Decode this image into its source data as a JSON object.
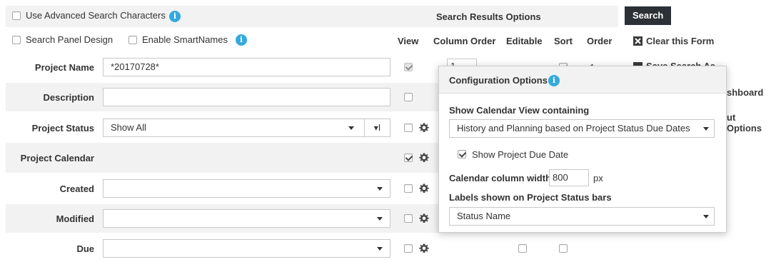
{
  "top_options": {
    "advanced_chars_label": "Use Advanced Search Characters",
    "panel_design_label": "Search Panel Design",
    "smartnames_label": "Enable SmartNames"
  },
  "results_options": {
    "title": "Search Results Options",
    "columns": [
      "View",
      "Column Order",
      "Editable",
      "Sort",
      "Order"
    ]
  },
  "fields": {
    "project_name": {
      "label": "Project Name",
      "value": "*20170728*"
    },
    "description": {
      "label": "Description",
      "value": ""
    },
    "project_status": {
      "label": "Project Status",
      "value": "Show All"
    },
    "project_calendar": {
      "label": "Project Calendar"
    },
    "created": {
      "label": "Created",
      "value": ""
    },
    "modified": {
      "label": "Modified",
      "value": ""
    },
    "due": {
      "label": "Due",
      "value": ""
    }
  },
  "row1_extras": {
    "column_order_value": "1",
    "order_value": "1"
  },
  "actions": {
    "search": "Search",
    "clear_form": "Clear this Form",
    "save_search_as": "Save Search As",
    "dashboard": "shboard",
    "layout_options": "ut Options"
  },
  "config_popup": {
    "title": "Configuration Options",
    "calendar_view_label": "Show Calendar View containing",
    "calendar_view_value": "History and Planning based on Project Status Due Dates",
    "show_due_date_label": "Show Project Due Date",
    "column_width_label": "Calendar column width",
    "column_width_value": "800",
    "column_width_unit": "px",
    "status_bars_label": "Labels shown on Project Status bars",
    "status_bars_value": "Status Name"
  },
  "colors": {
    "accent": "#33a9dd",
    "button_dark": "#2b3136",
    "band": "#f2f2f2"
  },
  "icons": [
    "info-icon",
    "gear-icon",
    "clear-form-icon",
    "save-icon",
    "caret-down-icon"
  ]
}
